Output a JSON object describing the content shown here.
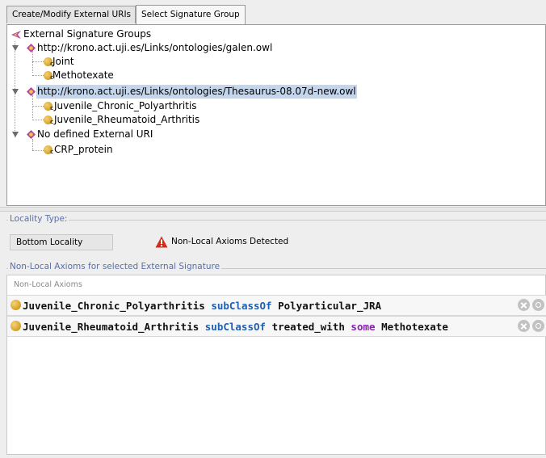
{
  "tabs": [
    {
      "label": "Create/Modify External URIs"
    },
    {
      "label": "Select Signature Group"
    }
  ],
  "tree": {
    "root_label": "External Signature Groups",
    "groups": [
      {
        "label": "http://krono.act.uji.es/Links/ontologies/galen.owl",
        "children": [
          "Joint",
          "Methotexate"
        ]
      },
      {
        "label": "http://krono.act.uji.es/Links/ontologies/Thesaurus-08.07d-new.owl",
        "children": [
          "Juvenile_Chronic_Polyarthritis",
          "Juvenile_Rheumatoid_Arthritis"
        ],
        "selected": true
      },
      {
        "label": "No defined External URI",
        "children": [
          "CRP_protein"
        ]
      }
    ]
  },
  "locality": {
    "group_title": "Locality Type:",
    "value": "Bottom Locality",
    "warning": "Non-Local Axioms Detected"
  },
  "axioms": {
    "group_title": "Non-Local Axioms for selected External Signature",
    "header": "Non-Local Axioms",
    "rows": [
      {
        "subject": "Juvenile_Chronic_Polyarthritis",
        "op": "subClassOf",
        "object": "Polyarticular_JRA",
        "restriction_prop": "",
        "restriction_kw": "",
        "restriction_obj": ""
      },
      {
        "subject": "Juvenile_Rheumatoid_Arthritis",
        "op": "subClassOf",
        "object": "",
        "restriction_prop": "treated_with",
        "restriction_kw": "some",
        "restriction_obj": "Methotexate"
      }
    ]
  },
  "colors": {
    "op": "#1f5fb0",
    "some": "#8a1fb0",
    "group_title": "#5a6fa6",
    "selection": "#c3d6ee",
    "class_dot": "#d4a020"
  }
}
